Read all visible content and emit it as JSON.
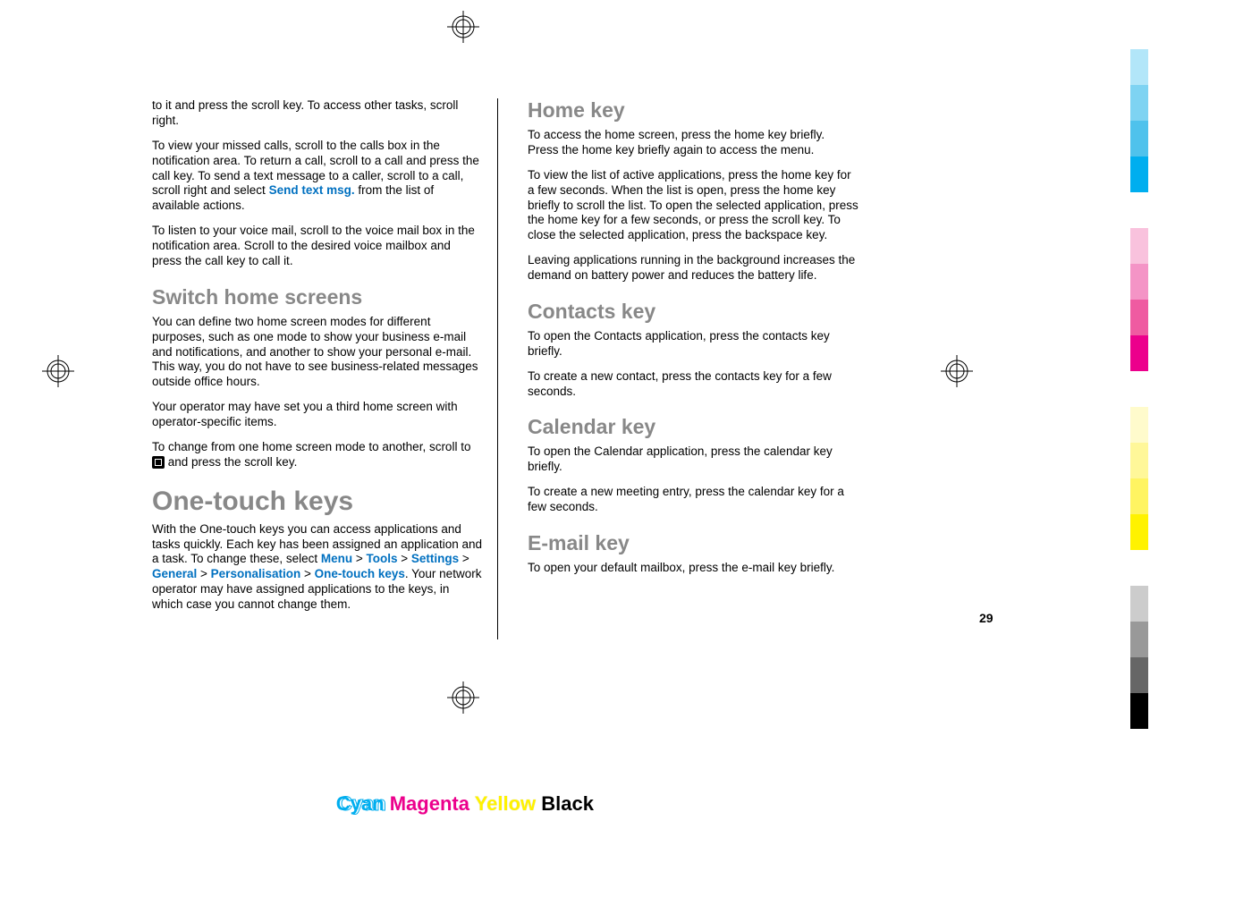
{
  "col1": {
    "p1a": "to it and press the scroll key. To access other tasks, scroll right.",
    "p2a": "To view your missed calls, scroll to the calls box in the notification area. To return a call, scroll to a call and press the call key. To send a text message to a caller, scroll to a call, scroll right and select ",
    "p2link": "Send text msg.",
    "p2b": " from the list of available actions.",
    "p3": "To listen to your voice mail, scroll to the voice mail box in the notification area. Scroll to the desired voice mailbox and press the call key to call it.",
    "h2a": "Switch home screens",
    "p4": "You can define two home screen modes for different purposes, such as one mode to show your business e-mail and notifications, and another to show your personal e-mail. This way, you do not have to see business-related messages outside office hours.",
    "p5": "Your operator may have set you a third home screen with operator-specific items.",
    "p6a": "To change from one home screen mode to another, scroll to ",
    "p6b": " and press the scroll key.",
    "h1a": "One-touch keys",
    "p7a": "With the One-touch keys you can access applications and tasks quickly. Each key has been assigned an application and a task. To change these, select ",
    "menu": "Menu",
    "tools": "Tools",
    "settings": "Settings",
    "general": "General",
    "personalisation": "Personalisation",
    "onetouch": "One-touch keys",
    "gt": " > ",
    "p7b": ". Your network operator may have assigned applications to the keys, in which case you cannot change them."
  },
  "col2": {
    "h2a": "Home key",
    "p1": "To access the home screen, press the home key briefly. Press the home key briefly again to access the menu.",
    "p2": "To view the list of active applications, press the home key for a few seconds. When the list is open, press the home key briefly to scroll the list. To open the selected application, press the home key for a few seconds, or press the scroll key. To close the selected application, press the backspace key.",
    "p3": "Leaving applications running in the background increases the demand on battery power and reduces the battery life.",
    "h2b": "Contacts key",
    "p4": "To open the Contacts application, press the contacts key briefly.",
    "p5": "To create a new contact, press the contacts key for a few seconds.",
    "h2c": "Calendar key",
    "p6": "To open the Calendar application, press the calendar key briefly.",
    "p7": "To create a new meeting entry, press the calendar key for a few seconds.",
    "h2d": "E-mail key",
    "p8": "To open your default mailbox, press the e-mail key briefly."
  },
  "pagenum": "29",
  "cmyk": {
    "c": "Cyan",
    "m": "Magenta",
    "y": "Yellow",
    "k": "Black"
  }
}
